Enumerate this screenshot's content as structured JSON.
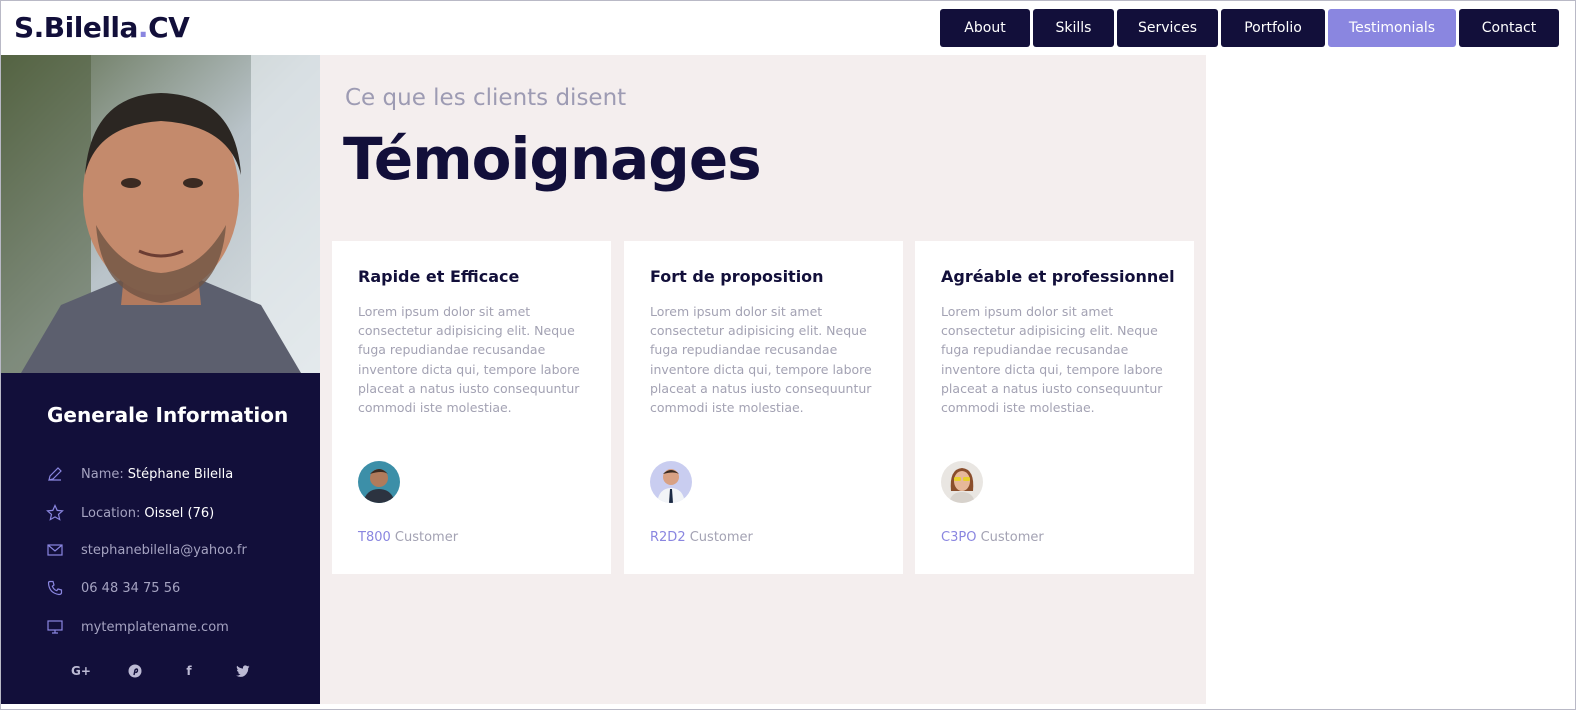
{
  "header": {
    "logo_text": "S.Bilella",
    "logo_dot": ".",
    "logo_suffix": "CV",
    "nav": [
      {
        "label": "About"
      },
      {
        "label": "Skills"
      },
      {
        "label": "Services"
      },
      {
        "label": "Portfolio"
      },
      {
        "label": "Testimonials",
        "active": true
      },
      {
        "label": "Contact"
      }
    ]
  },
  "sidebar": {
    "title": "Generale Information",
    "rows": [
      {
        "icon": "pencil-icon",
        "label": "Name:",
        "value": "Stéphane Bilella"
      },
      {
        "icon": "star-icon",
        "label": "Location:",
        "value": "Oissel (76)"
      },
      {
        "icon": "mail-icon",
        "label": "stephanebilella@yahoo.fr",
        "value": ""
      },
      {
        "icon": "phone-icon",
        "label": "06 48 34 75 56",
        "value": ""
      },
      {
        "icon": "monitor-icon",
        "label": "mytemplatename.com",
        "value": ""
      }
    ],
    "socials": [
      {
        "icon": "google-plus-icon",
        "glyph": "G+"
      },
      {
        "icon": "pinterest-icon",
        "glyph": "P"
      },
      {
        "icon": "facebook-icon",
        "glyph": "f"
      },
      {
        "icon": "twitter-icon",
        "glyph": "t"
      }
    ]
  },
  "main": {
    "subtitle": "Ce que les clients disent",
    "title": "Témoignages",
    "testimonials": [
      {
        "title": "Rapide et Efficace",
        "text": "Lorem ipsum dolor sit amet consectetur adipisicing elit. Neque fuga repudiandae recusandae inventore dicta qui, tempore labore placeat a natus iusto consequuntur commodi iste molestiae.",
        "name": "T800",
        "role": "Customer"
      },
      {
        "title": "Fort de proposition",
        "text": "Lorem ipsum dolor sit amet consectetur adipisicing elit. Neque fuga repudiandae recusandae inventore dicta qui, tempore labore placeat a natus iusto consequuntur commodi iste molestiae.",
        "name": "R2D2",
        "role": "Customer"
      },
      {
        "title": "Agréable et professionnel",
        "text": "Lorem ipsum dolor sit amet consectetur adipisicing elit. Neque fuga repudiandae recusandae inventore dicta qui, tempore labore placeat a natus iusto consequuntur commodi iste molestiae.",
        "name": "C3PO",
        "role": "Customer"
      }
    ]
  },
  "colors": {
    "navy": "#120f3a",
    "accent": "#8a86e0",
    "main_bg": "#f4eeee",
    "muted_text": "#a3a2b3"
  }
}
